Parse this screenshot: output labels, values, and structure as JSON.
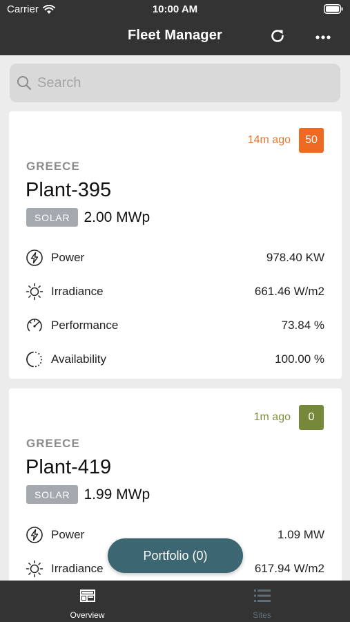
{
  "status_bar": {
    "carrier": "Carrier",
    "time": "10:00 AM"
  },
  "nav": {
    "title": "Fleet Manager",
    "refresh_icon": "refresh-icon",
    "more_icon": "more-horizontal-icon"
  },
  "search": {
    "placeholder": "Search",
    "value": ""
  },
  "plants": [
    {
      "updated": "14m ago",
      "updated_color": "#e8772e",
      "alarm_count": "50",
      "alarm_color": "#ee6a22",
      "country": "GREECE",
      "name": "Plant-395",
      "type": "SOLAR",
      "capacity": "2.00 MWp",
      "metrics": [
        {
          "label": "Power",
          "value": "978.40 KW",
          "icon": "lightning-icon"
        },
        {
          "label": "Irradiance",
          "value": "661.46 W/m2",
          "icon": "sun-icon"
        },
        {
          "label": "Performance",
          "value": "73.84 %",
          "icon": "gauge-icon"
        },
        {
          "label": "Availability",
          "value": "100.00 %",
          "icon": "availability-circle-icon"
        }
      ]
    },
    {
      "updated": "1m ago",
      "updated_color": "#7c8f3c",
      "alarm_count": "0",
      "alarm_color": "#76893a",
      "country": "GREECE",
      "name": "Plant-419",
      "type": "SOLAR",
      "capacity": "1.99 MWp",
      "metrics": [
        {
          "label": "Power",
          "value": "1.09 MW",
          "icon": "lightning-icon"
        },
        {
          "label": "Irradiance",
          "value": "617.94 W/m2",
          "icon": "sun-icon"
        }
      ]
    }
  ],
  "portfolio_button": "Portfolio (0)",
  "tabs": [
    {
      "label": "Overview",
      "icon": "dashboard-icon",
      "active": true
    },
    {
      "label": "Sites",
      "icon": "list-icon",
      "active": false
    }
  ],
  "colors": {
    "bar_background": "#333333",
    "page_background": "#ececec",
    "portfolio_button": "#3c6672",
    "tag_background": "#a4a9b0"
  }
}
